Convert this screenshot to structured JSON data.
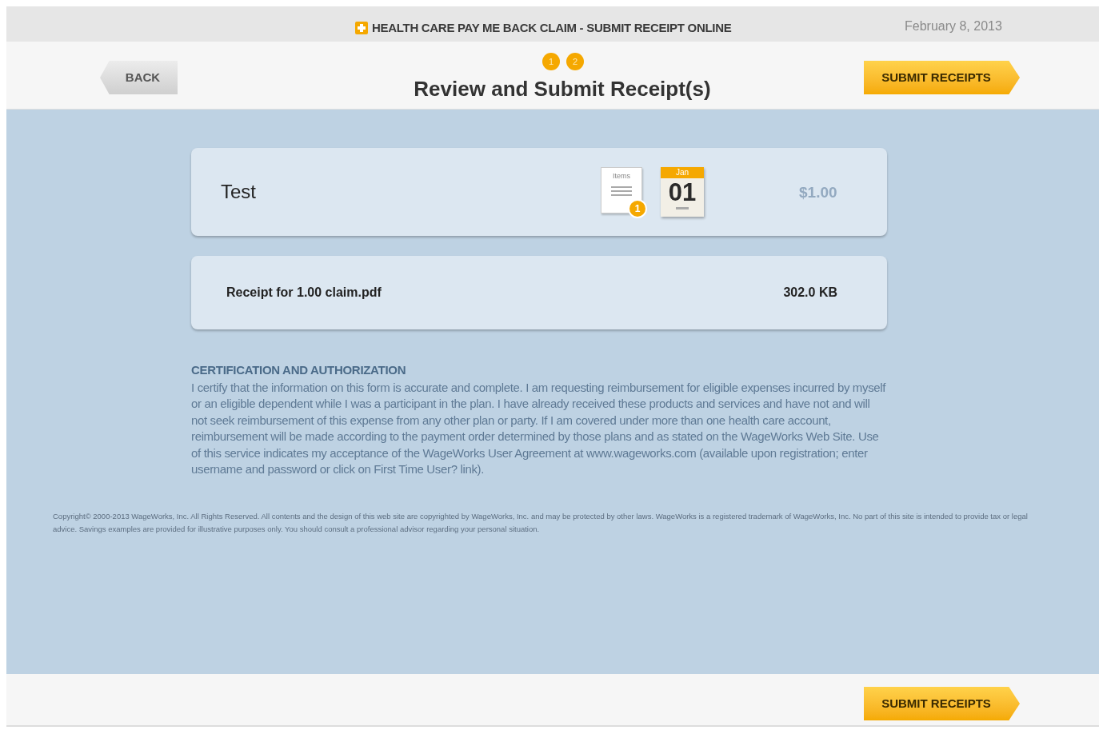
{
  "header": {
    "title": "HEALTH CARE PAY ME BACK CLAIM - SUBMIT RECEIPT ONLINE",
    "date": "February 8, 2013"
  },
  "toolbar": {
    "back_button": "BACK",
    "steps": [
      {
        "label": "1",
        "selected": true
      },
      {
        "label": "2",
        "selected": true
      }
    ],
    "heading": "Review and Submit Receipt(s)",
    "submit_button": "SUBMIT RECEIPTS"
  },
  "claim": {
    "name": "Test",
    "items_icon": {
      "label": "Items",
      "count": "1"
    },
    "date_icon": {
      "month": "Jan",
      "day": "01"
    },
    "amount": "$1.00"
  },
  "attachment": {
    "file_name": "Receipt for 1.00 claim.pdf",
    "size": "302.0 KB"
  },
  "certification": {
    "heading": "CERTIFICATION AND AUTHORIZATION",
    "text": "I certify that the information on this form is accurate and complete. I am requesting reimbursement for eligible expenses incurred by myself or an eligible dependent while I was a participant in the plan. I have already received these products and services and have not and will not seek reimbursement of this expense from any other plan or party. If I am covered under more than one health care account, reimbursement will be made according to the payment order determined by those plans and as stated on the WageWorks Web Site. Use of this service indicates my acceptance of the WageWorks User Agreement at www.wageworks.com (available upon registration; enter username and password or click on First Time User? link)."
  },
  "copyright": "Copyright© 2000-2013 WageWorks, Inc. All Rights Reserved. All contents and the design of this web site are copyrighted by WageWorks, Inc. and may be protected by other laws. WageWorks is a registered trademark of WageWorks, Inc. No part of this site is intended to provide tax or legal advice. Savings examples are provided for illustrative purposes only. You should consult a professional advisor regarding your personal situation.",
  "footer": {
    "submit_button": "SUBMIT RECEIPTS"
  }
}
